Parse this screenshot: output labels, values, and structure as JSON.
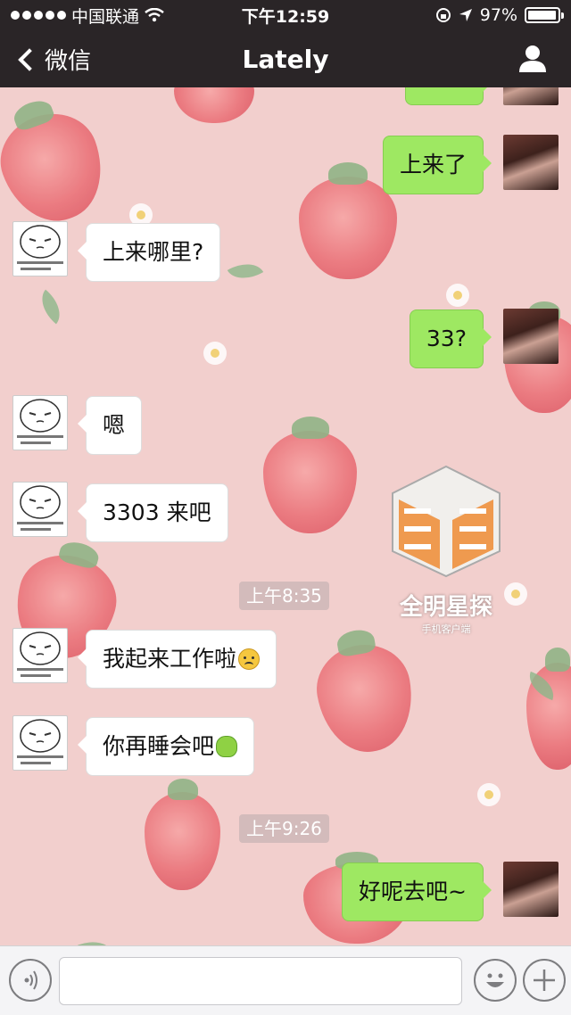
{
  "status_bar": {
    "carrier": "中国联通",
    "time": "下午12:59",
    "battery": "97%",
    "battery_level": 0.97
  },
  "nav": {
    "back_label": "微信",
    "title": "Lately"
  },
  "messages": [
    {
      "side": "left",
      "text": "上来哪里?"
    },
    {
      "side": "right",
      "text": "上来了"
    },
    {
      "side": "right",
      "text": "33?"
    },
    {
      "side": "left",
      "text": "嗯"
    },
    {
      "side": "left",
      "text": "3303 来吧"
    },
    {
      "side": "left",
      "text": "我起来工作啦",
      "emoji": "sad-face-icon"
    },
    {
      "side": "left",
      "text": "你再睡会吧",
      "emoji": "green-bun-icon"
    },
    {
      "side": "right",
      "text": "好呢去吧~"
    }
  ],
  "timestamps": [
    "上午8:35",
    "上午9:26"
  ],
  "watermark": {
    "title": "全明星探",
    "subtitle": "手机客户端"
  },
  "colors": {
    "bar_bg": "#2a2527",
    "bubble_green": "#9ee862",
    "bubble_white": "#ffffff",
    "chat_bg": "#f2cfcd"
  }
}
